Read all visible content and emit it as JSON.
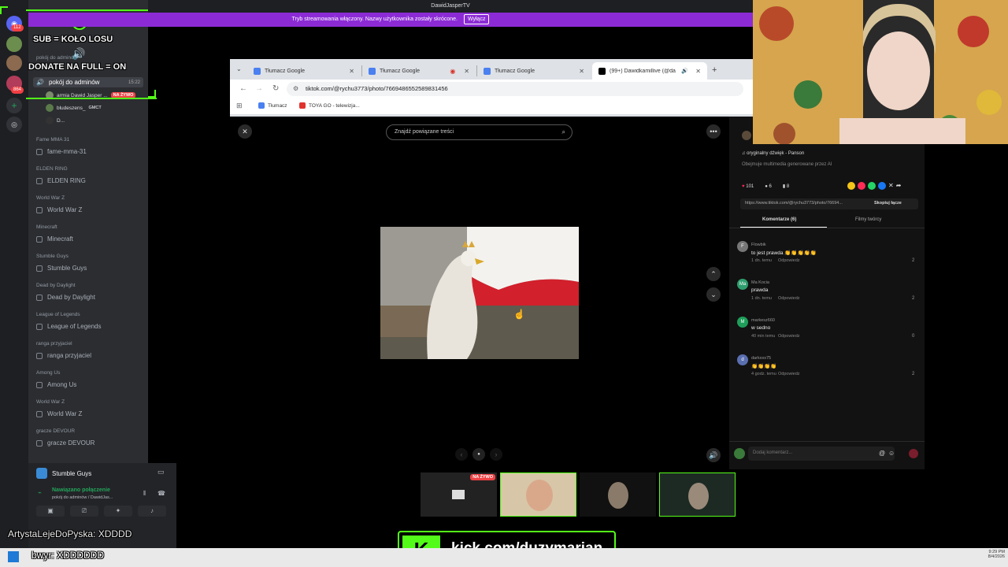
{
  "window_title": "DawidJasperTV",
  "stream_notice": {
    "text": "Tryb streamowania włączony. Nazwy użytkownika zostały skrócone.",
    "button": "Wyłącz"
  },
  "overlay": {
    "sub_line": "SUB = KOŁO LOSU",
    "donate_line": "DONATE NA FULL = ON",
    "bottom_left": "ArtystaLejeDoPyska: XDDDD",
    "bottom_left2": "bwyr: XDDDDDD"
  },
  "discord": {
    "rail_badges": [
      "112",
      "864"
    ],
    "server_name": "DawidJasperTV",
    "voice_category": "pokój do adminów",
    "voice_channel": {
      "label": "pokój do adminów",
      "time": "15:22"
    },
    "voice_users": [
      {
        "name": "armia Dawid Jasper ...",
        "live": "NA ŻYWO"
      },
      {
        "name": "bludeszens_",
        "tag": "GMCT"
      },
      {
        "name": "D..."
      }
    ],
    "channels": [
      {
        "category": "Fame MMA 31",
        "name": "fame-mma-31"
      },
      {
        "category": "ELDEN RING",
        "name": "ELDEN RING"
      },
      {
        "category": "World War Z",
        "name": "World War Z"
      },
      {
        "category": "Minecraft",
        "name": "Minecraft"
      },
      {
        "category": "Stumble Guys",
        "name": "Stumble Guys"
      },
      {
        "category": "Dead by Daylight",
        "name": "Dead by Daylight"
      },
      {
        "category": "League of Legends",
        "name": "League of Legends"
      },
      {
        "category": "ranga przyjaciel",
        "name": "ranga przyjaciel"
      },
      {
        "category": "Among Us",
        "name": "Among Us"
      },
      {
        "category": "World War Z",
        "name": "World War Z"
      },
      {
        "category": "gracze DEVOUR",
        "name": "gracze DEVOUR"
      }
    ],
    "activity": "Stumble Guys",
    "connection": {
      "status": "Nawiązano połączenie",
      "detail": "pokój do adminów / DawidJas..."
    }
  },
  "browser": {
    "tabs": [
      {
        "label": "Tłumacz Google"
      },
      {
        "label": "Tłumacz Google"
      },
      {
        "label": "Tłumacz Google"
      },
      {
        "label": "(99+) Dawidkamillive (@da"
      }
    ],
    "url": "tiktok.com/@rychu3773/photo/7669486552589831456",
    "bookmarks": [
      "Tłumacz",
      "TOYA GO - telewizja..."
    ]
  },
  "tiktok": {
    "search_placeholder": "Znajdź powiązane treści",
    "sound": "oryginalny dźwięk - Panson",
    "ai_note": "Obejmuje multimedia generowane przez AI",
    "likes": "101",
    "comments_count": "6",
    "saves": "8",
    "share_url": "https://www.tiktok.com/@rychu3773/photo/76694...",
    "copy_link": "Skopiuj łącze",
    "tab_comments": "Komentarze (6)",
    "tab_creator": "Filmy twórcy",
    "comments": [
      {
        "initial": "F",
        "user": "Flowbik",
        "text": "to jest prawda 👏👏👏👏👏",
        "time": "1 dn. temu",
        "reply": "Odpowiedz",
        "likes": "2",
        "color": "#777"
      },
      {
        "initial": "Ma",
        "user": "Ma Kocia",
        "text": "prawda",
        "time": "1 dn. temu",
        "reply": "Odpowiedz",
        "likes": "2",
        "color": "#2f9e6f"
      },
      {
        "initial": "M",
        "user": "markesz660",
        "text": "w sedno",
        "time": "40 min temu",
        "reply": "Odpowiedz",
        "likes": "0",
        "color": "#1e9e5a"
      },
      {
        "initial": "d",
        "user": "darkxxx75",
        "text": "👏👏👏👏",
        "time": "4 godz. temu",
        "reply": "Odpowiedz",
        "likes": "2",
        "color": "#5a6fb0"
      }
    ],
    "add_comment_placeholder": "Dodaj komentarz..."
  },
  "thumb_live": "NA ŻYWO",
  "kick_url": "kick.com/duzymarian",
  "clock": {
    "time": "9:29 PM",
    "date": "8/4/2026"
  }
}
